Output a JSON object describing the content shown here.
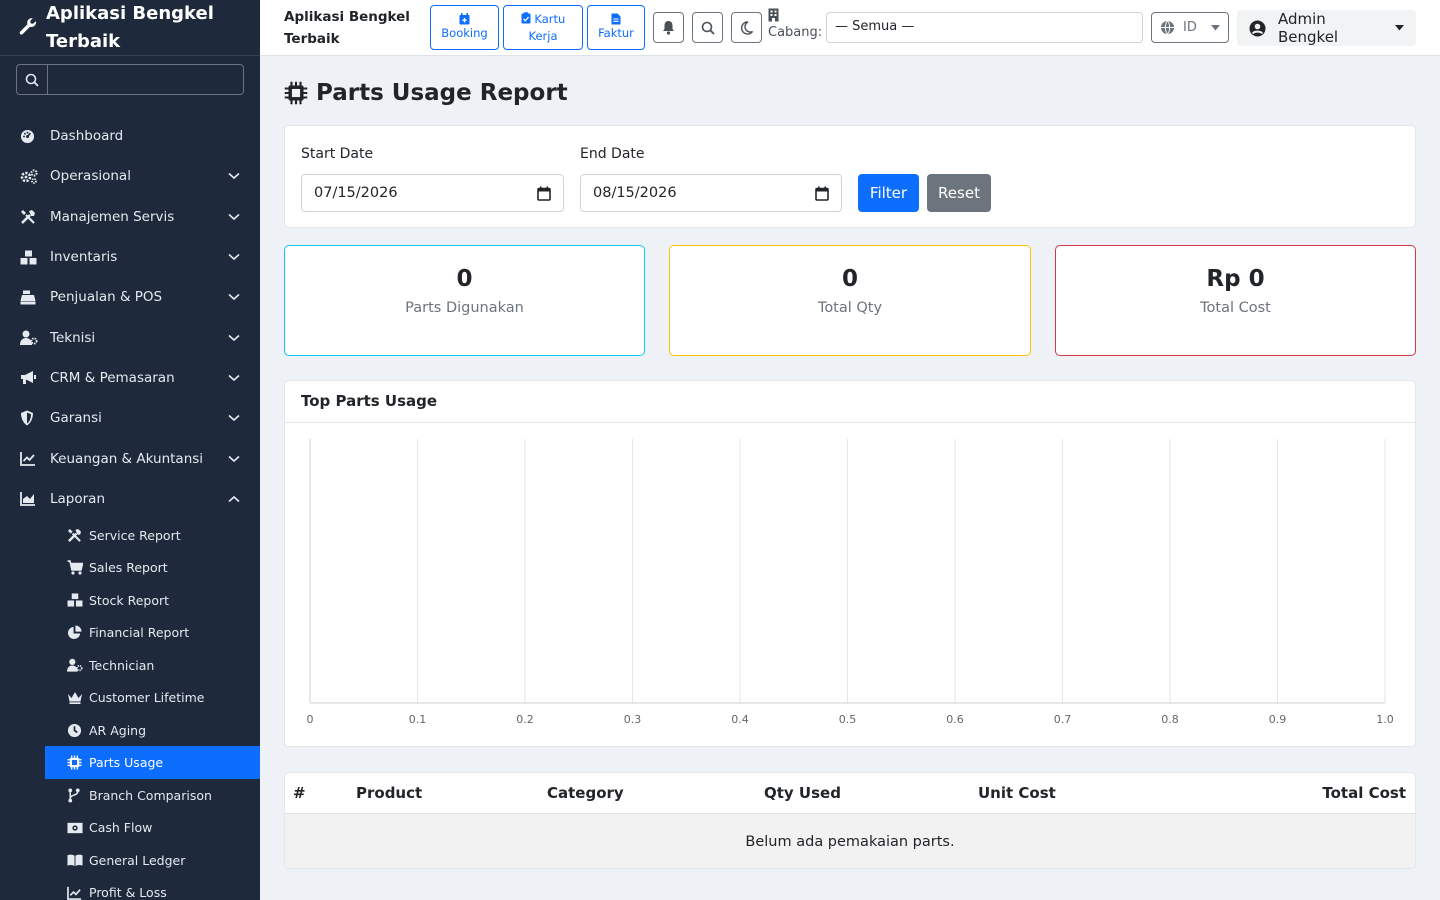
{
  "app": {
    "name": "Aplikasi Bengkel Terbaik"
  },
  "sidebar": {
    "search_placeholder": "",
    "items": [
      {
        "label": "Dashboard",
        "icon": "dashboard-icon"
      },
      {
        "label": "Operasional",
        "icon": "cogs-icon"
      },
      {
        "label": "Manajemen Servis",
        "icon": "tools-icon"
      },
      {
        "label": "Inventaris",
        "icon": "boxes-icon"
      },
      {
        "label": "Penjualan & POS",
        "icon": "cash-register-icon"
      },
      {
        "label": "Teknisi",
        "icon": "user-cog-icon"
      },
      {
        "label": "CRM & Pemasaran",
        "icon": "bullhorn-icon"
      },
      {
        "label": "Garansi",
        "icon": "shield-icon"
      },
      {
        "label": "Keuangan & Akuntansi",
        "icon": "chart-line-icon"
      },
      {
        "label": "Laporan",
        "icon": "chart-area-icon"
      }
    ],
    "laporan_sub": [
      {
        "label": "Service Report",
        "icon": "tools-icon"
      },
      {
        "label": "Sales Report",
        "icon": "cart-icon"
      },
      {
        "label": "Stock Report",
        "icon": "boxes-icon"
      },
      {
        "label": "Financial Report",
        "icon": "pie-chart-icon"
      },
      {
        "label": "Technician",
        "icon": "user-cog-icon"
      },
      {
        "label": "Customer Lifetime",
        "icon": "crown-icon"
      },
      {
        "label": "AR Aging",
        "icon": "clock-icon"
      },
      {
        "label": "Parts Usage",
        "icon": "microchip-icon",
        "active": true
      },
      {
        "label": "Branch Comparison",
        "icon": "code-branch-icon"
      },
      {
        "label": "Cash Flow",
        "icon": "money-bill-icon"
      },
      {
        "label": "General Ledger",
        "icon": "book-open-icon"
      },
      {
        "label": "Profit & Loss",
        "icon": "chart-line-icon"
      }
    ]
  },
  "topbar": {
    "brand": "Aplikasi Bengkel Terbaik",
    "quick": [
      {
        "label": "Booking",
        "icon": "calendar-plus-icon"
      },
      {
        "label": "Kartu Kerja",
        "icon": "clipboard-check-icon"
      },
      {
        "label": "Faktur",
        "icon": "file-invoice-icon"
      }
    ],
    "cabang_label": "Cabang:",
    "cabang_value": "— Semua —",
    "lang": "ID",
    "user": "Admin Bengkel"
  },
  "page": {
    "title": "Parts Usage Report",
    "filter": {
      "start_label": "Start Date",
      "start_value": "07/15/2026",
      "end_label": "End Date",
      "end_value": "08/15/2026",
      "filter_btn": "Filter",
      "reset_btn": "Reset"
    },
    "stats": [
      {
        "value": "0",
        "label": "Parts Digunakan",
        "color": "#0dcaf0"
      },
      {
        "value": "0",
        "label": "Total Qty",
        "color": "#ffc107"
      },
      {
        "value": "Rp 0",
        "label": "Total Cost",
        "color": "#dc3545"
      }
    ],
    "chart_title": "Top Parts Usage",
    "table": {
      "headers": [
        "#",
        "Product",
        "Category",
        "Qty Used",
        "Unit Cost",
        "Total Cost"
      ],
      "empty": "Belum ada pemakaian parts."
    }
  },
  "chart_data": {
    "type": "bar",
    "orientation": "horizontal",
    "title": "Top Parts Usage",
    "categories": [],
    "values": [],
    "xlim": [
      0,
      1.0
    ],
    "x_ticks": [
      "0",
      "0.1",
      "0.2",
      "0.3",
      "0.4",
      "0.5",
      "0.6",
      "0.7",
      "0.8",
      "0.9",
      "1.0"
    ],
    "grid": true
  }
}
